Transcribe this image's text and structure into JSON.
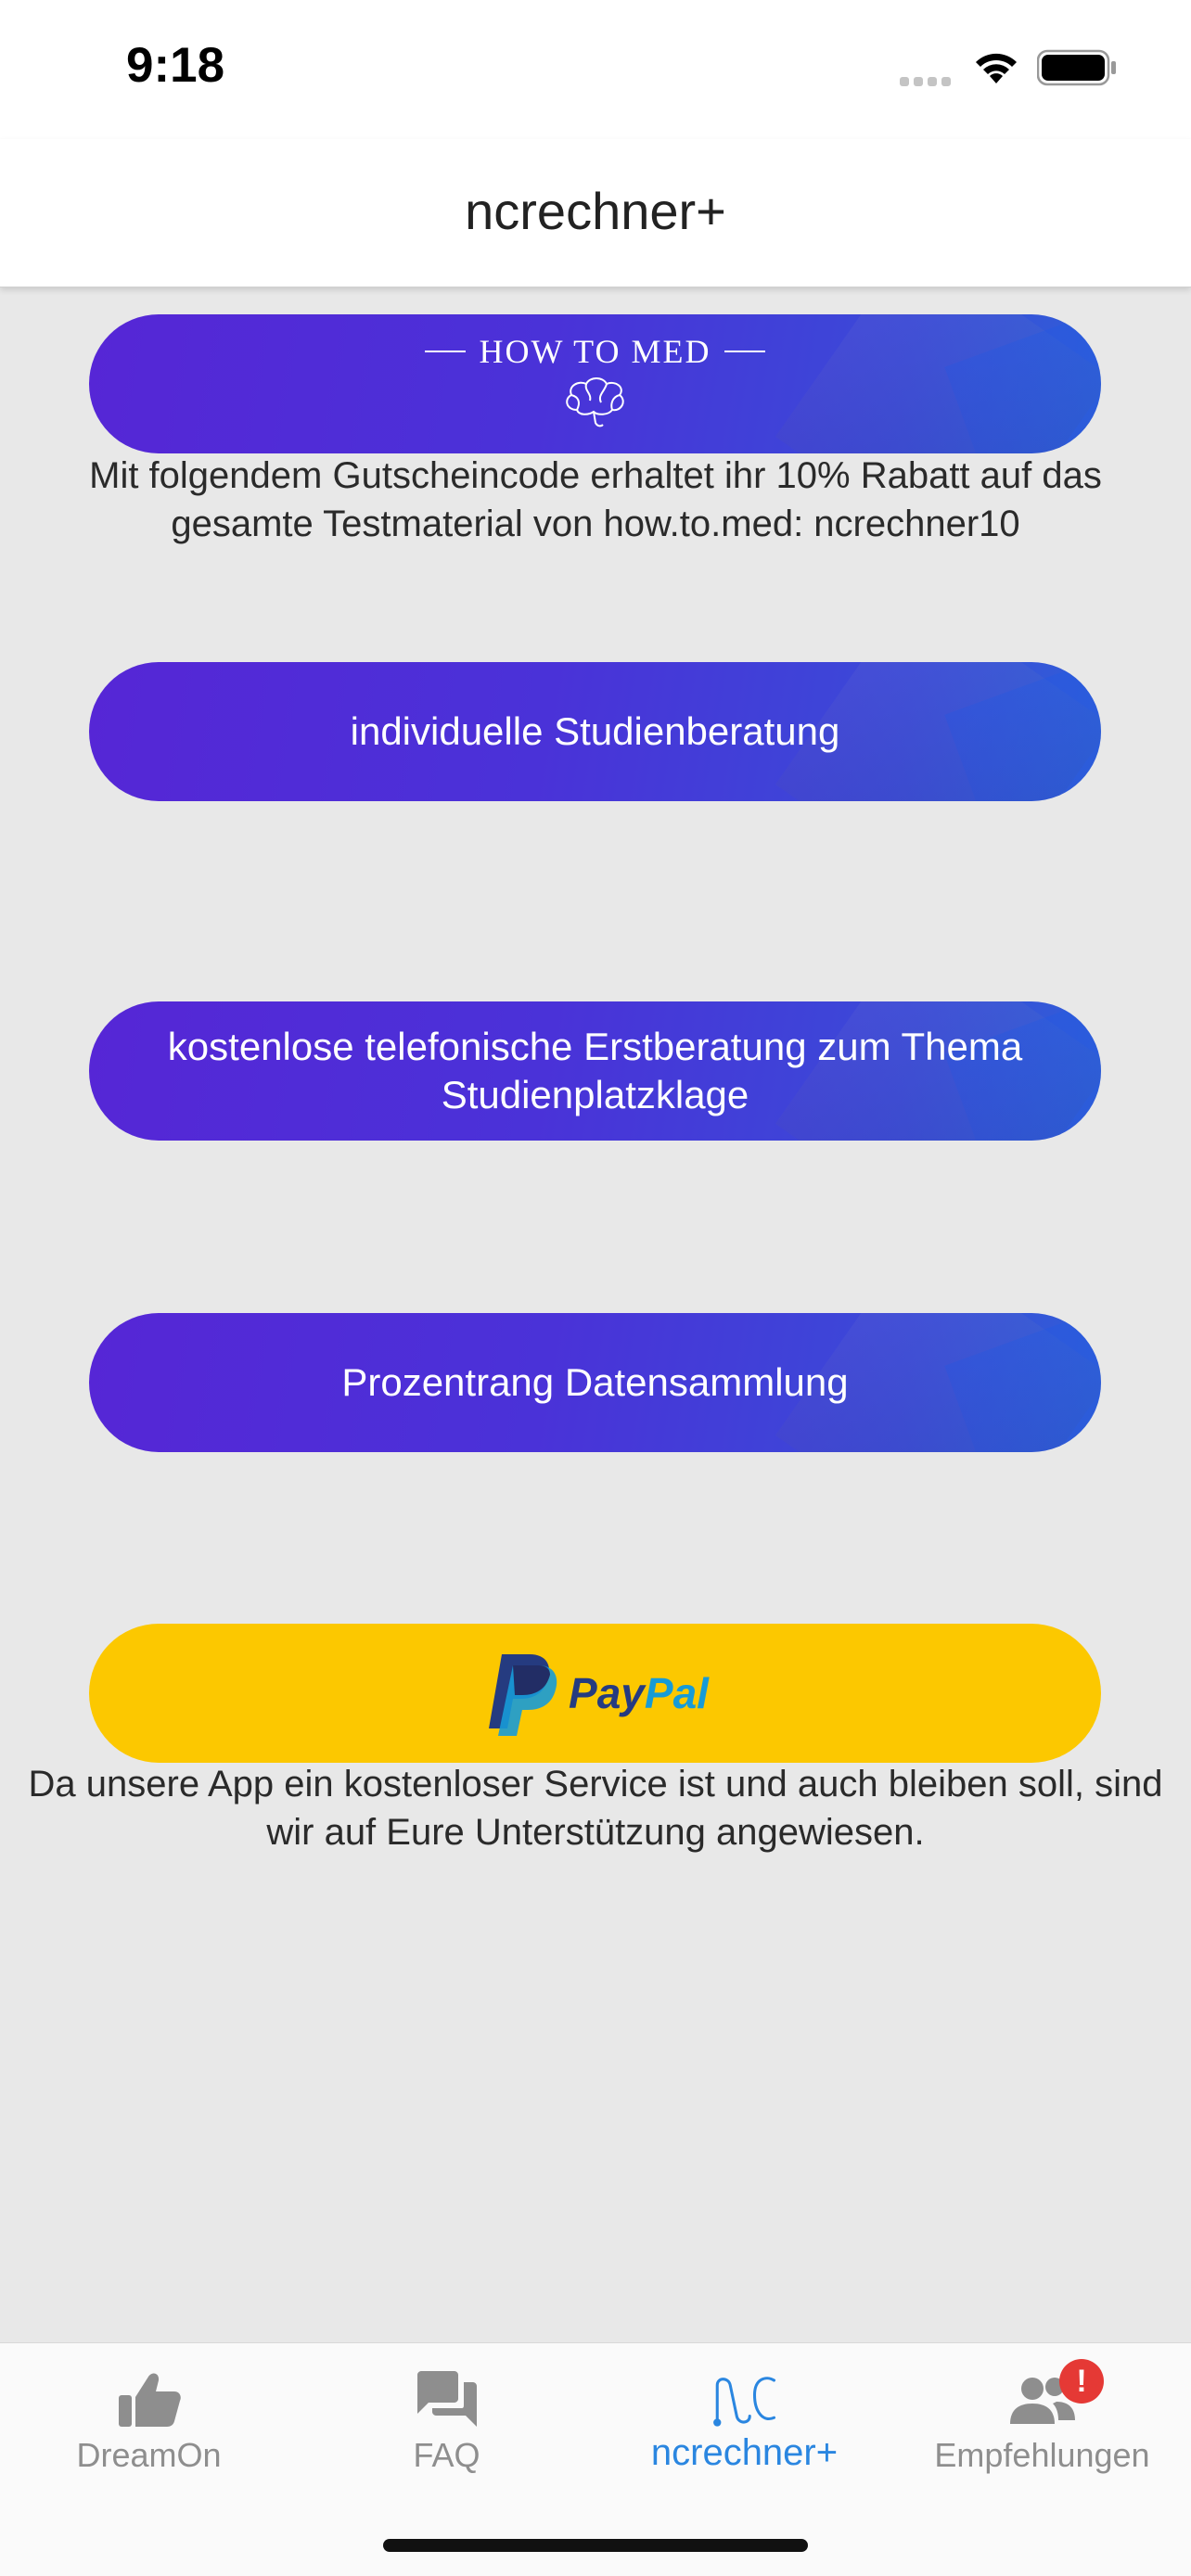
{
  "status_bar": {
    "time": "9:18"
  },
  "nav": {
    "title": "ncrechner+"
  },
  "howtomed": {
    "logo_text": "HOW TO MED",
    "description": "Mit folgendem Gutscheincode erhaltet ihr 10% Rabatt auf das gesamte Testmaterial von how.to.med: ncrechner10"
  },
  "buttons": {
    "studienberatung": "individuelle Studienberatung",
    "studienplatzklage": "kostenlose telefonische Erstberatung zum Thema Studienplatzklage",
    "datensammlung": "Prozentrang Datensammlung"
  },
  "paypal": {
    "logo_pay": "Pay",
    "logo_pal": "Pal",
    "description": "Da unsere App ein kostenloser Service ist und auch bleiben soll, sind wir auf Eure Unterstützung angewiesen."
  },
  "tabs": [
    {
      "label": "DreamOn",
      "icon": "thumbs-up-icon"
    },
    {
      "label": "FAQ",
      "icon": "chat-bubbles-icon"
    },
    {
      "label": "ncrechner+",
      "icon": "nc-logo-icon"
    },
    {
      "label": "Empfehlungen",
      "icon": "people-icon"
    }
  ],
  "badge": {
    "text": "!"
  },
  "colors": {
    "accent": "#2a86e0",
    "button_gradient_start": "#5626d6",
    "button_gradient_end": "#2f60d8",
    "paypal_yellow": "#fcc800",
    "badge_red": "#e53935"
  }
}
